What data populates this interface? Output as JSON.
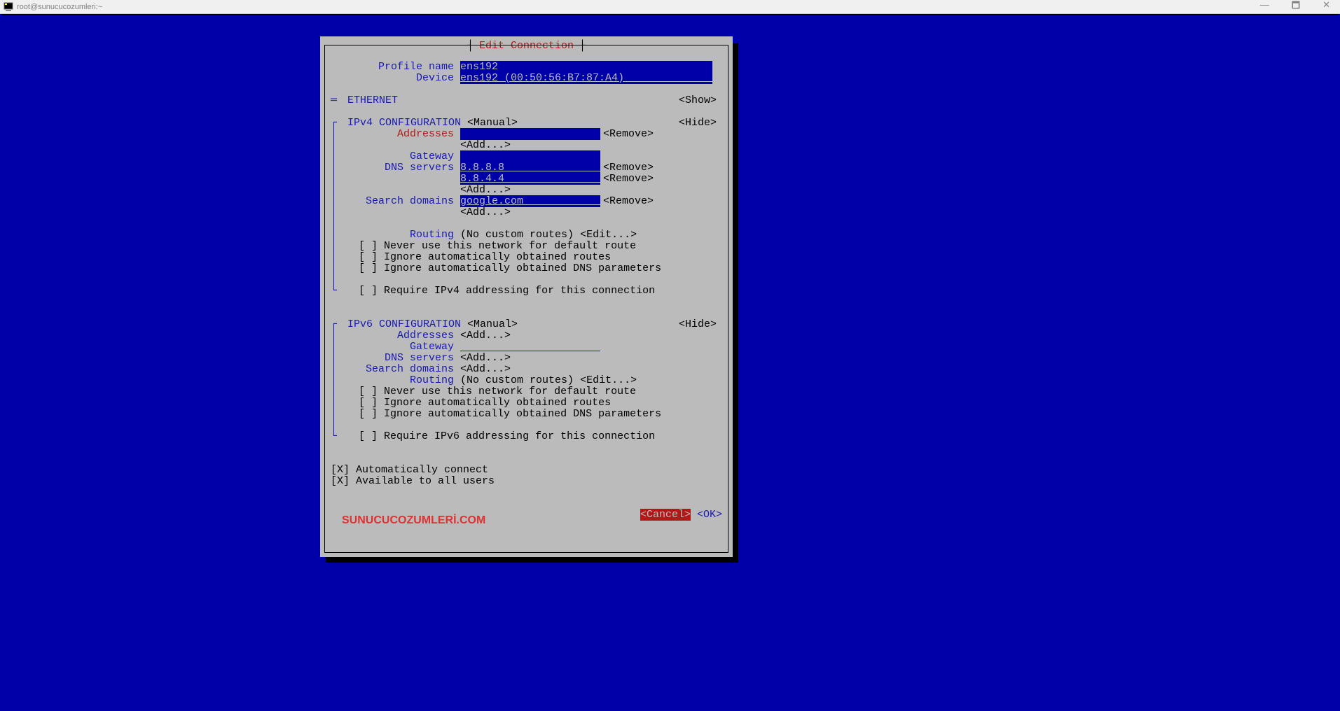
{
  "window": {
    "title": "root@sunucucozumleri:~",
    "min": "—",
    "max": "🗖",
    "close": "✕"
  },
  "dialog": {
    "title": "Edit Connection",
    "profile_name_label": "Profile name",
    "profile_name_value": "ens192                                  ",
    "device_label": "Device",
    "device_value": "ens192 (00:50:56:B7:87:A4)              ",
    "ethernet_label": "ETHERNET",
    "ethernet_toggle": "═",
    "show_action": "<Show>",
    "hide_action": "<Hide>",
    "ipv4": {
      "label": "IPv4 CONFIGURATION",
      "mode": "<Manual>",
      "addresses_label": "Addresses",
      "addresses_value": "                         ",
      "gateway_label": "Gateway",
      "gateway_value": "                         ",
      "dns_label": "DNS servers",
      "dns1": "8.8.8.8                  ",
      "dns2": "8.8.4.4                  ",
      "search_label": "Search domains",
      "search_value": "google.com               ",
      "add_action": "<Add...>",
      "remove_action": "<Remove>",
      "routing_label": "Routing",
      "routing_value": "(No custom routes)",
      "edit_action": "<Edit...>",
      "chk_never_default": "Never use this network for default route",
      "chk_ignore_routes": "Ignore automatically obtained routes",
      "chk_ignore_dns": "Ignore automatically obtained DNS parameters",
      "chk_require": "Require IPv4 addressing for this connection"
    },
    "ipv6": {
      "label": "IPv6 CONFIGURATION",
      "mode": "<Manual>",
      "addresses_label": "Addresses",
      "gateway_label": "Gateway",
      "dns_label": "DNS servers",
      "search_label": "Search domains",
      "add_action": "<Add...>",
      "routing_label": "Routing",
      "routing_value": "(No custom routes)",
      "edit_action": "<Edit...>",
      "chk_never_default": "Never use this network for default route",
      "chk_ignore_routes": "Ignore automatically obtained routes",
      "chk_ignore_dns": "Ignore automatically obtained DNS parameters",
      "chk_require": "Require IPv6 addressing for this connection"
    },
    "auto_connect": "Automatically connect",
    "all_users": "Available to all users",
    "cancel": "<Cancel>",
    "ok": "<OK>",
    "watermark": "SUNUCUCOZUMLERİ.COM",
    "unchecked": "[ ]",
    "checked": "[X]",
    "pipe_open": "┌",
    "pipe_mid": "│",
    "pipe_close": "└"
  }
}
